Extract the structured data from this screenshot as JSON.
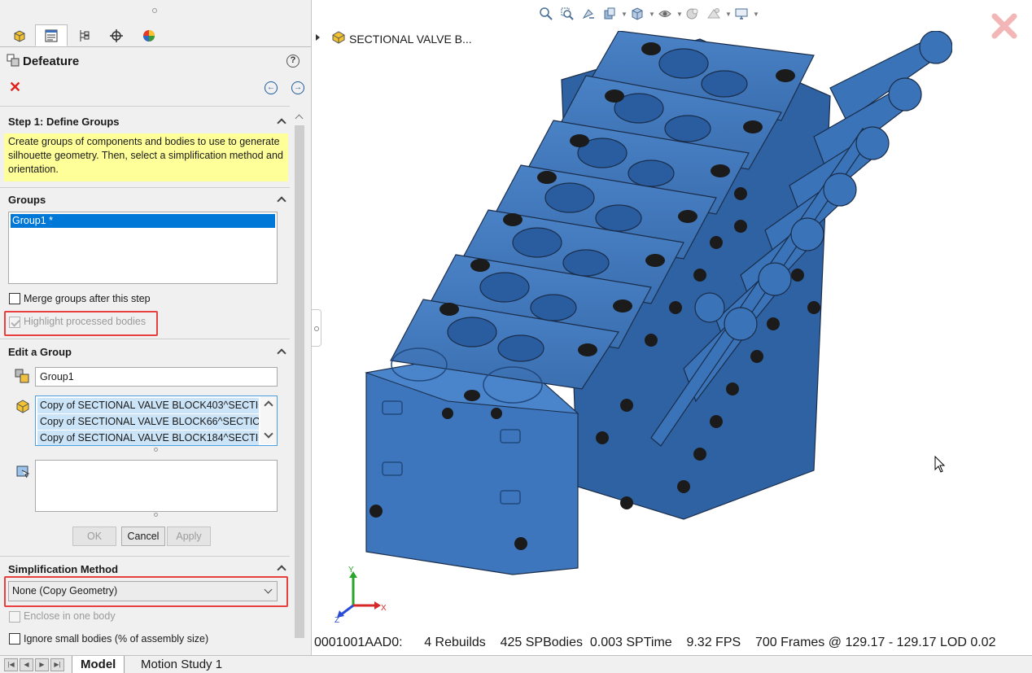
{
  "property_manager": {
    "title": "Defeature",
    "help_glyph": "?",
    "cancel_glyph": "✕",
    "back_glyph": "←",
    "next_glyph": "→",
    "tabs": [
      "feature-manager",
      "property-manager",
      "configuration-manager",
      "dimxpert-manager",
      "display-manager"
    ],
    "step1": {
      "title": "Step 1: Define Groups",
      "message": "Create groups of components and bodies to use to generate silhouette geometry. Then, select a simplification method and orientation."
    },
    "groups": {
      "title": "Groups",
      "items": [
        "Group1 *"
      ],
      "merge_label": "Merge groups after this step",
      "highlight_label": "Highlight processed bodies"
    },
    "edit_group": {
      "title": "Edit a Group",
      "name_value": "Group1",
      "components": [
        "Copy of SECTIONAL VALVE BLOCK403^SECTIC",
        "Copy of SECTIONAL VALVE BLOCK66^SECTION",
        "Copy of SECTIONAL VALVE BLOCK184^SECTIC"
      ],
      "ok_label": "OK",
      "cancel_label": "Cancel",
      "apply_label": "Apply"
    },
    "simplification": {
      "title": "Simplification Method",
      "selected": "None (Copy Geometry)",
      "enclose_label": "Enclose in one body",
      "ignore_small_label": "Ignore small bodies (% of assembly size)"
    }
  },
  "graphics": {
    "tree_label": "SECTIONAL VALVE B...",
    "status_line": "0001001AAD0:      4 Rebuilds    425 SPBodies  0.003 SPTime    9.32 FPS    700 Frames @ 129.17 - 129.17 LOD 0.02",
    "triad": {
      "x": "X",
      "y": "Y",
      "z": "Z"
    },
    "model_color": "#3a73b8",
    "hud_icons": [
      "zoom-to-fit-icon",
      "zoom-to-area-icon",
      "previous-view-icon",
      "section-view-icon",
      "view-orientation-icon",
      "display-style-icon",
      "hide-show-items-icon",
      "edit-appearance-icon",
      "apply-scene-icon",
      "view-settings-icon"
    ]
  },
  "bottom_tabs": {
    "nav": [
      "|◀",
      "◀",
      "▶",
      "▶|"
    ],
    "tabs": [
      "Model",
      "Motion Study 1"
    ]
  }
}
